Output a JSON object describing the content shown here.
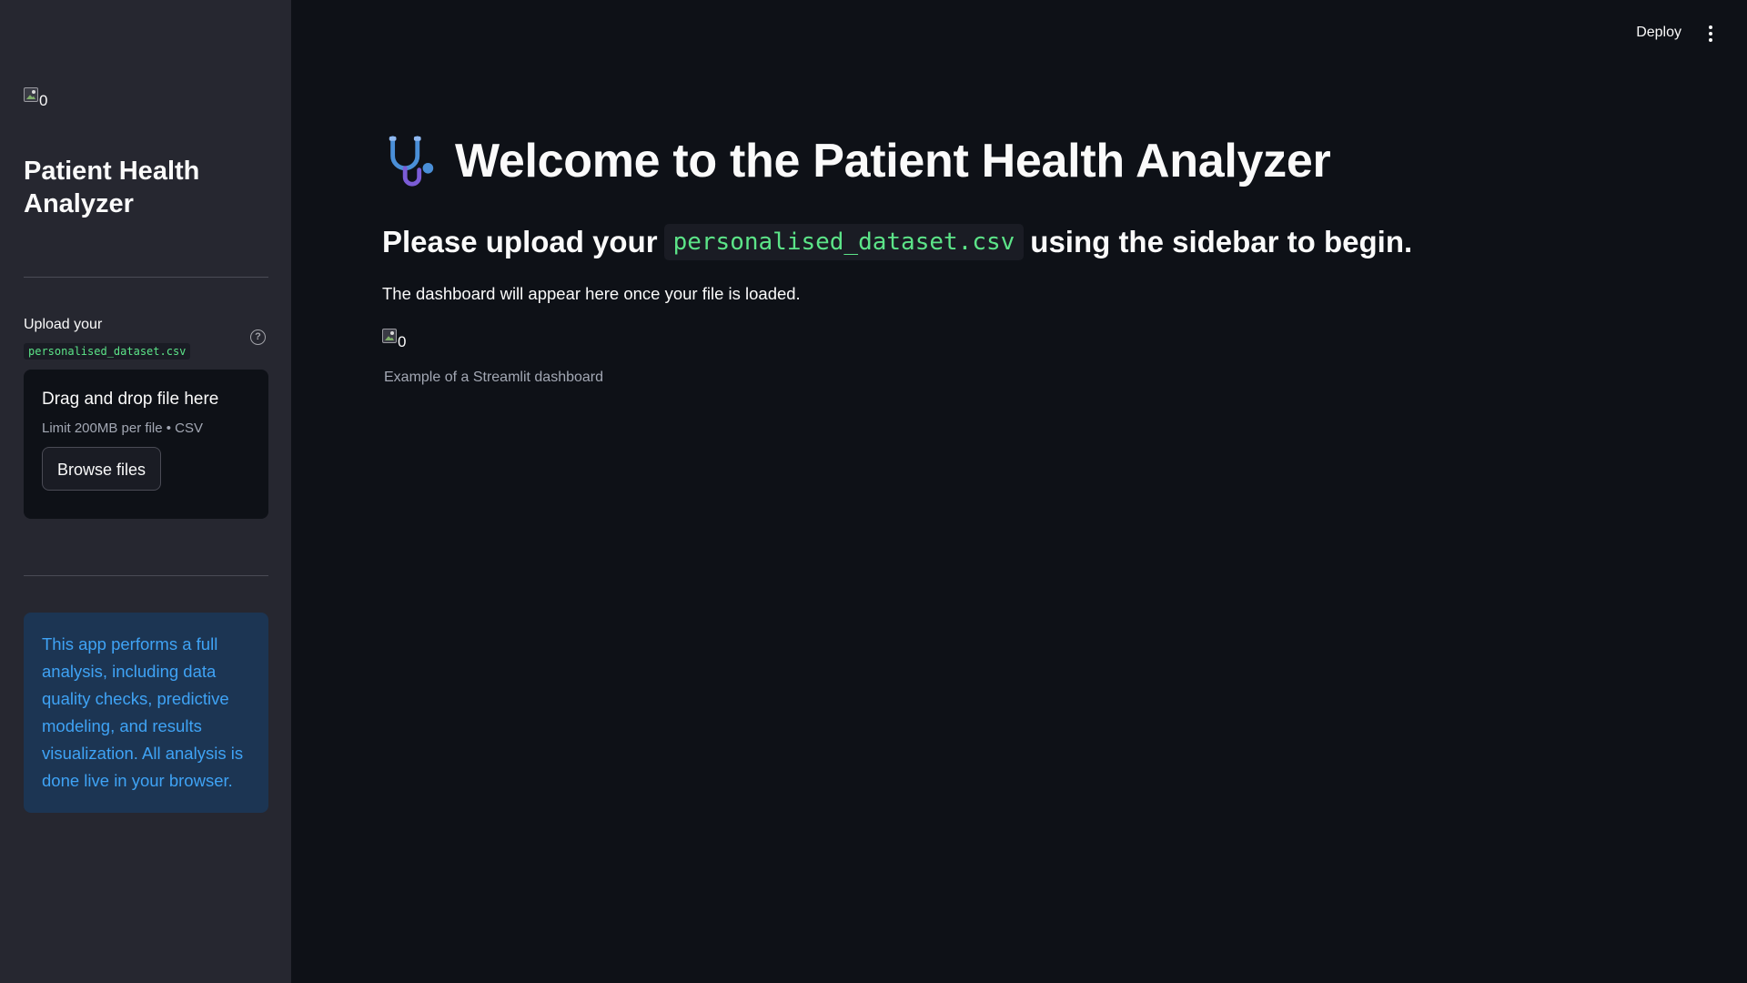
{
  "sidebar": {
    "logo_alt": "0",
    "title": "Patient Health Analyzer",
    "upload_label": "Upload your",
    "upload_filename": "personalised_dataset.csv",
    "dropzone": {
      "title": "Drag and drop file here",
      "limit": "Limit 200MB per file • CSV",
      "button_label": "Browse files"
    },
    "info_text": "This app performs a full analysis, including data quality checks, predictive modeling, and results visualization. All analysis is done live in your browser."
  },
  "header": {
    "deploy_label": "Deploy",
    "menu_icon": "kebab-menu-icon"
  },
  "main": {
    "title_icon": "stethoscope-icon",
    "title": "Welcome to the Patient Health Analyzer",
    "subheading_prefix": "Please upload your",
    "subheading_code": "personalised_dataset.csv",
    "subheading_suffix": "using the sidebar to begin.",
    "body": "The dashboard will appear here once your file is loaded.",
    "image_alt": "0",
    "image_caption": "Example of a Streamlit dashboard"
  },
  "colors": {
    "background": "#0e1117",
    "sidebar": "#262730",
    "code_text": "#5ce488",
    "info_text": "#3fa3f5",
    "info_bg": "#1c3553"
  }
}
